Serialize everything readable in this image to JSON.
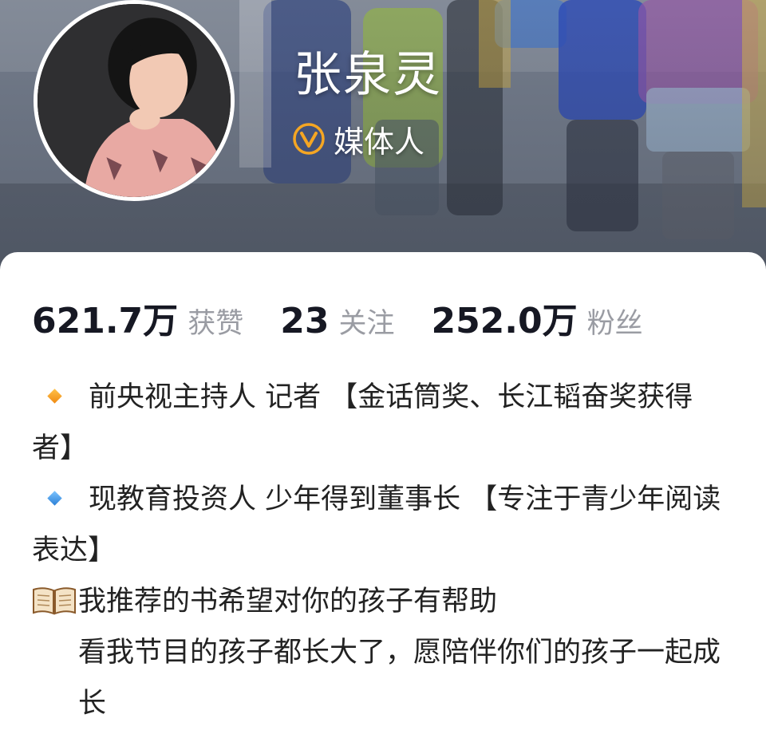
{
  "profile": {
    "name": "张泉灵",
    "verification": "媒体人",
    "verify_icon": "verified-v-badge-icon",
    "accent_color": "#f5a623"
  },
  "stats": [
    {
      "value": "621.7万",
      "label": "获赞"
    },
    {
      "value": "23",
      "label": "关注"
    },
    {
      "value": "252.0万",
      "label": "粉丝"
    }
  ],
  "bio": {
    "line1_text": "前央视主持人 记者 【金话筒奖、长江韬奋奖获得者】",
    "line1_icon": "orange-diamond-icon",
    "line2_text": "现教育投资人 少年得到董事长 【专注于青少年阅读表达】",
    "line2_icon": "blue-diamond-icon",
    "line3_text": "我推荐的书希望对你的孩子有帮助",
    "line3_icon": "open-book-icon",
    "line4_text": "看我节目的孩子都长大了，愿陪伴你们的孩子一起成长"
  }
}
